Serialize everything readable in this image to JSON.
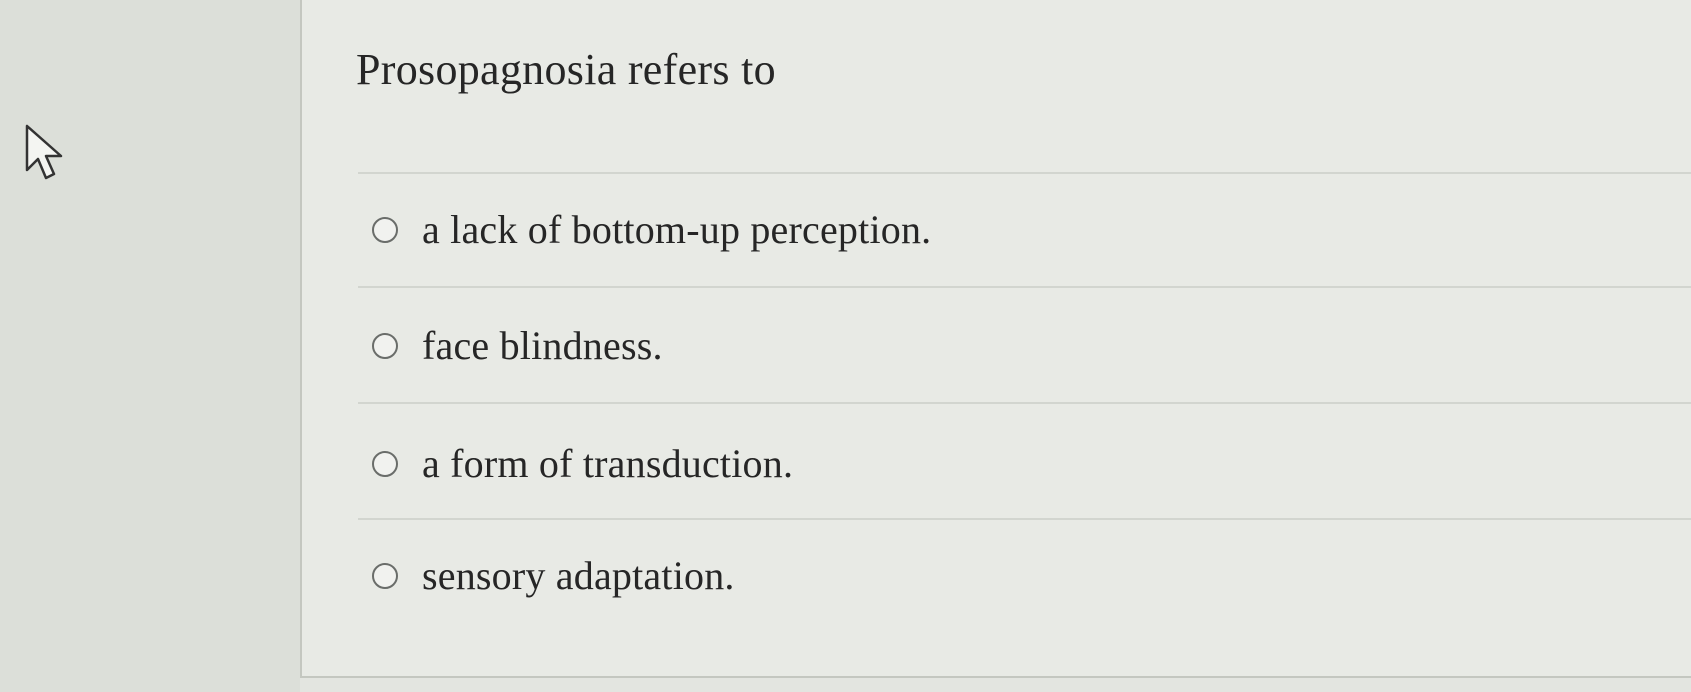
{
  "question": {
    "text": "Prosopagnosia refers to"
  },
  "options": [
    {
      "label": "a lack of bottom-up perception."
    },
    {
      "label": "face blindness."
    },
    {
      "label": "a form of transduction."
    },
    {
      "label": "sensory adaptation."
    }
  ],
  "cursor": {
    "icon": "mouse-pointer-icon"
  }
}
